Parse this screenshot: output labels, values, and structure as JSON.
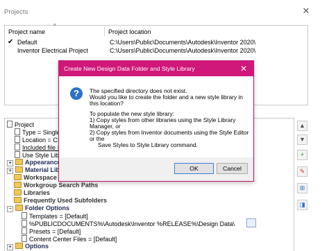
{
  "window": {
    "title": "Projects",
    "close_glyph": "✕",
    "columns": {
      "name": "Project name",
      "location": "Project location",
      "sort_caret": "^"
    },
    "projects": [
      {
        "active_mark": "✔",
        "name": "Default",
        "location": "C:\\Users\\Public\\Documents\\Autodesk\\Inventor 2020\\"
      },
      {
        "active_mark": "",
        "name": "Inventor Electrical Project",
        "location": "C:\\Users\\Public\\Documents\\Autodesk\\Inventor 2020\\"
      }
    ]
  },
  "tree": {
    "root": "Project",
    "type": "Type = Single ...",
    "location": "Location = C:\\...",
    "included": "Included file = ...",
    "use_style": "Use Style Libra...",
    "appearance": "Appearance L...",
    "material": "Material Libra...",
    "workspace": "Workspace",
    "workgroup": "Workgroup Search Paths",
    "libraries": "Libraries",
    "frequent": "Frequently Used Subfolders",
    "folder_options": "Folder Options",
    "templates": "Templates = [Default]",
    "design_data": "%PUBLICDOCUMENTS%\\Autodesk\\Inventor %RELEASE%\\Design Data\\",
    "presets": "Presets = [Default]",
    "content_center": "Content Center Files = [Default]",
    "options": "Options"
  },
  "side_buttons": [
    "▲",
    "▼",
    "+",
    "✎",
    "⊞",
    "◨"
  ],
  "dialog": {
    "title": "Create New Design Data Folder and Style Library",
    "close_glyph": "✕",
    "icon_glyph": "?",
    "lines": [
      "The specified directory does not exist.",
      "Would you like to create the folder and a new style library in",
      "this location?",
      "",
      "To populate the new style library:",
      "1) Copy styles from other libraries using the Style Library",
      "Manager, or",
      "2) Copy styles from Inventor documents using the Style Editor",
      "or the",
      "Save Styles to Style Library command."
    ],
    "ok_label": "OK",
    "cancel_label": "Cancel"
  }
}
